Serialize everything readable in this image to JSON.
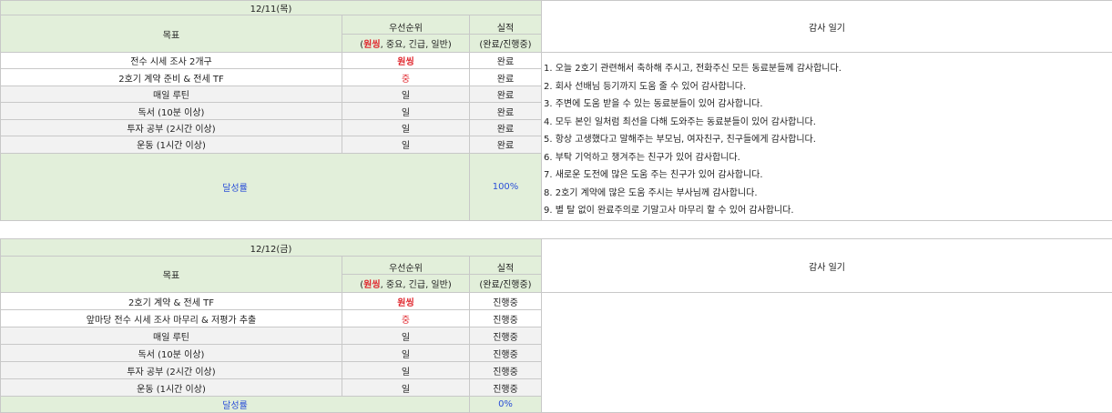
{
  "headers": {
    "goal": "목표",
    "priority": "우선순위",
    "priority_sub_prefix": "(",
    "priority_sub_top": "원씽",
    "priority_sub_rest": ", 중요, 긴급, 일반)",
    "result": "실적",
    "result_sub": "(완료/진행중)",
    "diary": "감사 일기",
    "achievement": "달성률"
  },
  "days": [
    {
      "date": "12/11(목)",
      "rows": [
        {
          "goal": "전수 시세 조사 2개구",
          "priority": "원씽",
          "priority_style": "red",
          "result": "완료"
        },
        {
          "goal": "2호기 계약 준비 & 전세 TF",
          "priority": "중",
          "priority_style": "redlight",
          "result": "완료"
        },
        {
          "goal": "매일 루틴",
          "priority": "일",
          "priority_style": "",
          "result": "완료"
        },
        {
          "goal": "독서 (10분 이상)",
          "priority": "일",
          "priority_style": "",
          "result": "완료"
        },
        {
          "goal": "투자 공부 (2시간 이상)",
          "priority": "일",
          "priority_style": "",
          "result": "완료"
        },
        {
          "goal": "운동 (1시간 이상)",
          "priority": "일",
          "priority_style": "",
          "result": "완료"
        }
      ],
      "achievement_value": "100%",
      "diary_entries": [
        "1. 오늘 2호기 관련해서 축하해 주시고, 전화주신 모든 동료분들께 감사합니다.",
        "2. 회사 선배님 등기까지 도움 줄 수 있어 감사합니다.",
        "3. 주변에 도움 받을 수 있는 동료분들이 있어 감사합니다.",
        "4. 모두 본인 일처럼 최선을 다해 도와주는 동료분들이 있어 감사합니다.",
        "5. 항상 고생했다고 말해주는 부모님, 여자친구, 친구들에게 감사합니다.",
        "6. 부탁 기억하고 챙겨주는 친구가 있어 감사합니다.",
        "7. 새로운 도전에 많은 도움 주는 친구가 있어 감사합니다.",
        "8. 2호기 계약에 많은 도움 주시는 부사님께 감사합니다.",
        "9. 별 탈 없이 완료주의로 기말고사 마무리 할 수 있어 감사합니다."
      ]
    },
    {
      "date": "12/12(금)",
      "rows": [
        {
          "goal": "2호기 계약 & 전세 TF",
          "priority": "원씽",
          "priority_style": "red",
          "result": "진행중"
        },
        {
          "goal": "앞마당 전수 시세 조사 마무리 & 저평가 추출",
          "priority": "중",
          "priority_style": "redlight",
          "result": "진행중"
        },
        {
          "goal": "매일 루틴",
          "priority": "일",
          "priority_style": "",
          "result": "진행중"
        },
        {
          "goal": "독서 (10분 이상)",
          "priority": "일",
          "priority_style": "",
          "result": "진행중"
        },
        {
          "goal": "투자 공부 (2시간 이상)",
          "priority": "일",
          "priority_style": "",
          "result": "진행중"
        },
        {
          "goal": "운동 (1시간 이상)",
          "priority": "일",
          "priority_style": "",
          "result": "진행중"
        }
      ],
      "achievement_value": "0%",
      "diary_entries": []
    }
  ],
  "colors": {
    "header_bg": "#e2efda",
    "priority_red": "#e0292f",
    "achievement_blue": "#2b4fd8"
  }
}
